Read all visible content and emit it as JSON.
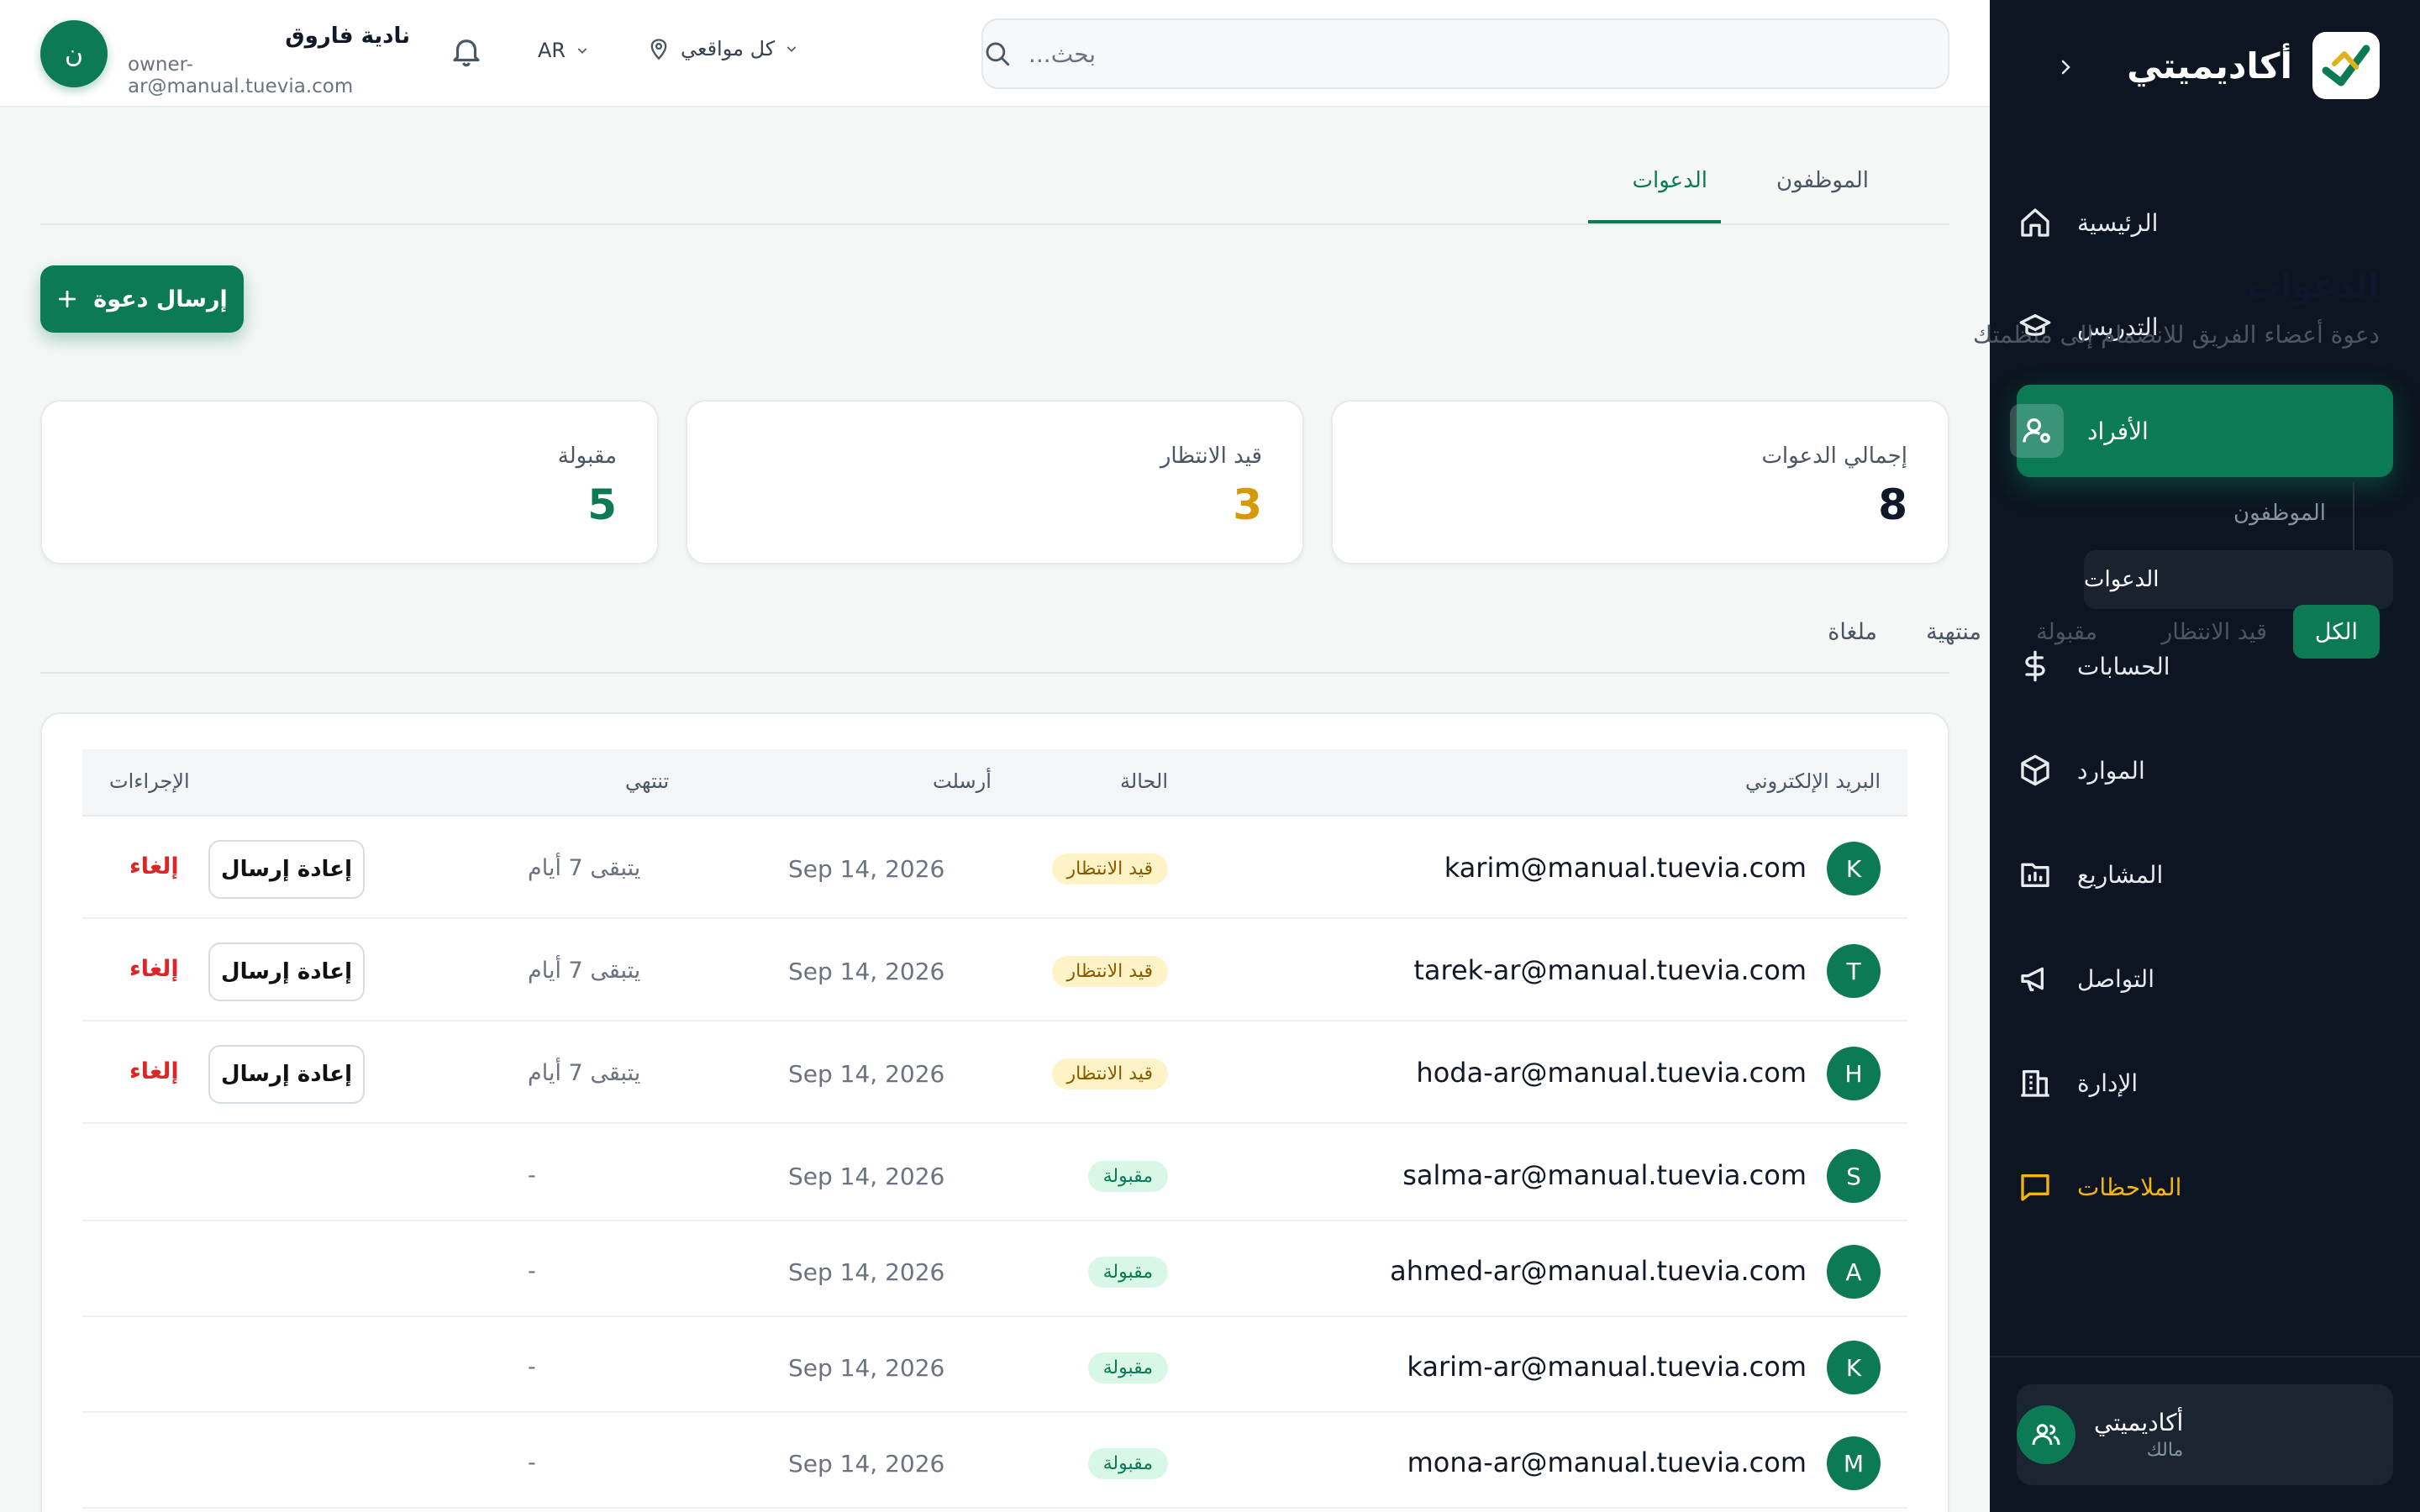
{
  "sidebar": {
    "brand": "أكاديميتي",
    "items": [
      {
        "label": "الرئيسية",
        "icon": "home-icon"
      },
      {
        "label": "التدريس",
        "icon": "graduation-cap-icon"
      },
      {
        "label": "الأفراد",
        "icon": "user-cog-icon"
      },
      {
        "label": "الحسابات",
        "icon": "dollar-icon"
      },
      {
        "label": "الموارد",
        "icon": "box-icon"
      },
      {
        "label": "المشاريع",
        "icon": "folder-chart-icon"
      },
      {
        "label": "التواصل",
        "icon": "megaphone-icon"
      },
      {
        "label": "الإدارة",
        "icon": "building-icon"
      },
      {
        "label": "الملاحظات",
        "icon": "message-square-icon"
      }
    ],
    "sub_items": [
      "الموظفون",
      "الدعوات"
    ],
    "footer": {
      "name": "أكاديميتي",
      "role": "مالك"
    }
  },
  "topbar": {
    "search_placeholder": "بحث...",
    "location": "كل مواقعي",
    "language": "AR",
    "user_name": "نادية فاروق",
    "user_email": "owner-ar@manual.tuevia.com",
    "avatar_letter": "ن"
  },
  "tabs": [
    "الموظفون",
    "الدعوات"
  ],
  "page": {
    "title": "الدعوات",
    "subtitle": "دعوة أعضاء الفريق للانضمام إلى منظمتك",
    "send_button": "إرسال دعوة"
  },
  "stats": [
    {
      "label": "إجمالي الدعوات",
      "value": "8",
      "color": "#111827"
    },
    {
      "label": "قيد الانتظار",
      "value": "3",
      "color": "#d49a0a"
    },
    {
      "label": "مقبولة",
      "value": "5",
      "color": "#0b7a55"
    }
  ],
  "filters": [
    "الكل",
    "قيد الانتظار",
    "مقبولة",
    "منتهية",
    "ملغاة"
  ],
  "table": {
    "headers": {
      "email": "البريد الإلكتروني",
      "status": "الحالة",
      "sent": "أرسلت",
      "expires": "تنتهي",
      "actions": "الإجراءات"
    },
    "resend_label": "إعادة إرسال",
    "cancel_label": "إلغاء",
    "rows": [
      {
        "letter": "K",
        "email": "karim@manual.tuevia.com",
        "status": "قيد الانتظار",
        "kind": "pending",
        "sent": "Sep 14, 2026",
        "expires": "يتبقى 7 أيام"
      },
      {
        "letter": "T",
        "email": "tarek-ar@manual.tuevia.com",
        "status": "قيد الانتظار",
        "kind": "pending",
        "sent": "Sep 14, 2026",
        "expires": "يتبقى 7 أيام"
      },
      {
        "letter": "H",
        "email": "hoda-ar@manual.tuevia.com",
        "status": "قيد الانتظار",
        "kind": "pending",
        "sent": "Sep 14, 2026",
        "expires": "يتبقى 7 أيام"
      },
      {
        "letter": "S",
        "email": "salma-ar@manual.tuevia.com",
        "status": "مقبولة",
        "kind": "accepted",
        "sent": "Sep 14, 2026",
        "expires": "-"
      },
      {
        "letter": "A",
        "email": "ahmed-ar@manual.tuevia.com",
        "status": "مقبولة",
        "kind": "accepted",
        "sent": "Sep 14, 2026",
        "expires": "-"
      },
      {
        "letter": "K",
        "email": "karim-ar@manual.tuevia.com",
        "status": "مقبولة",
        "kind": "accepted",
        "sent": "Sep 14, 2026",
        "expires": "-"
      },
      {
        "letter": "M",
        "email": "mona-ar@manual.tuevia.com",
        "status": "مقبولة",
        "kind": "accepted",
        "sent": "Sep 14, 2026",
        "expires": "-"
      }
    ]
  },
  "colors": {
    "accent": "#0b7a55",
    "sidebar_bg": "#0c1521",
    "warning": "#d49a0a",
    "danger": "#dc2626"
  }
}
